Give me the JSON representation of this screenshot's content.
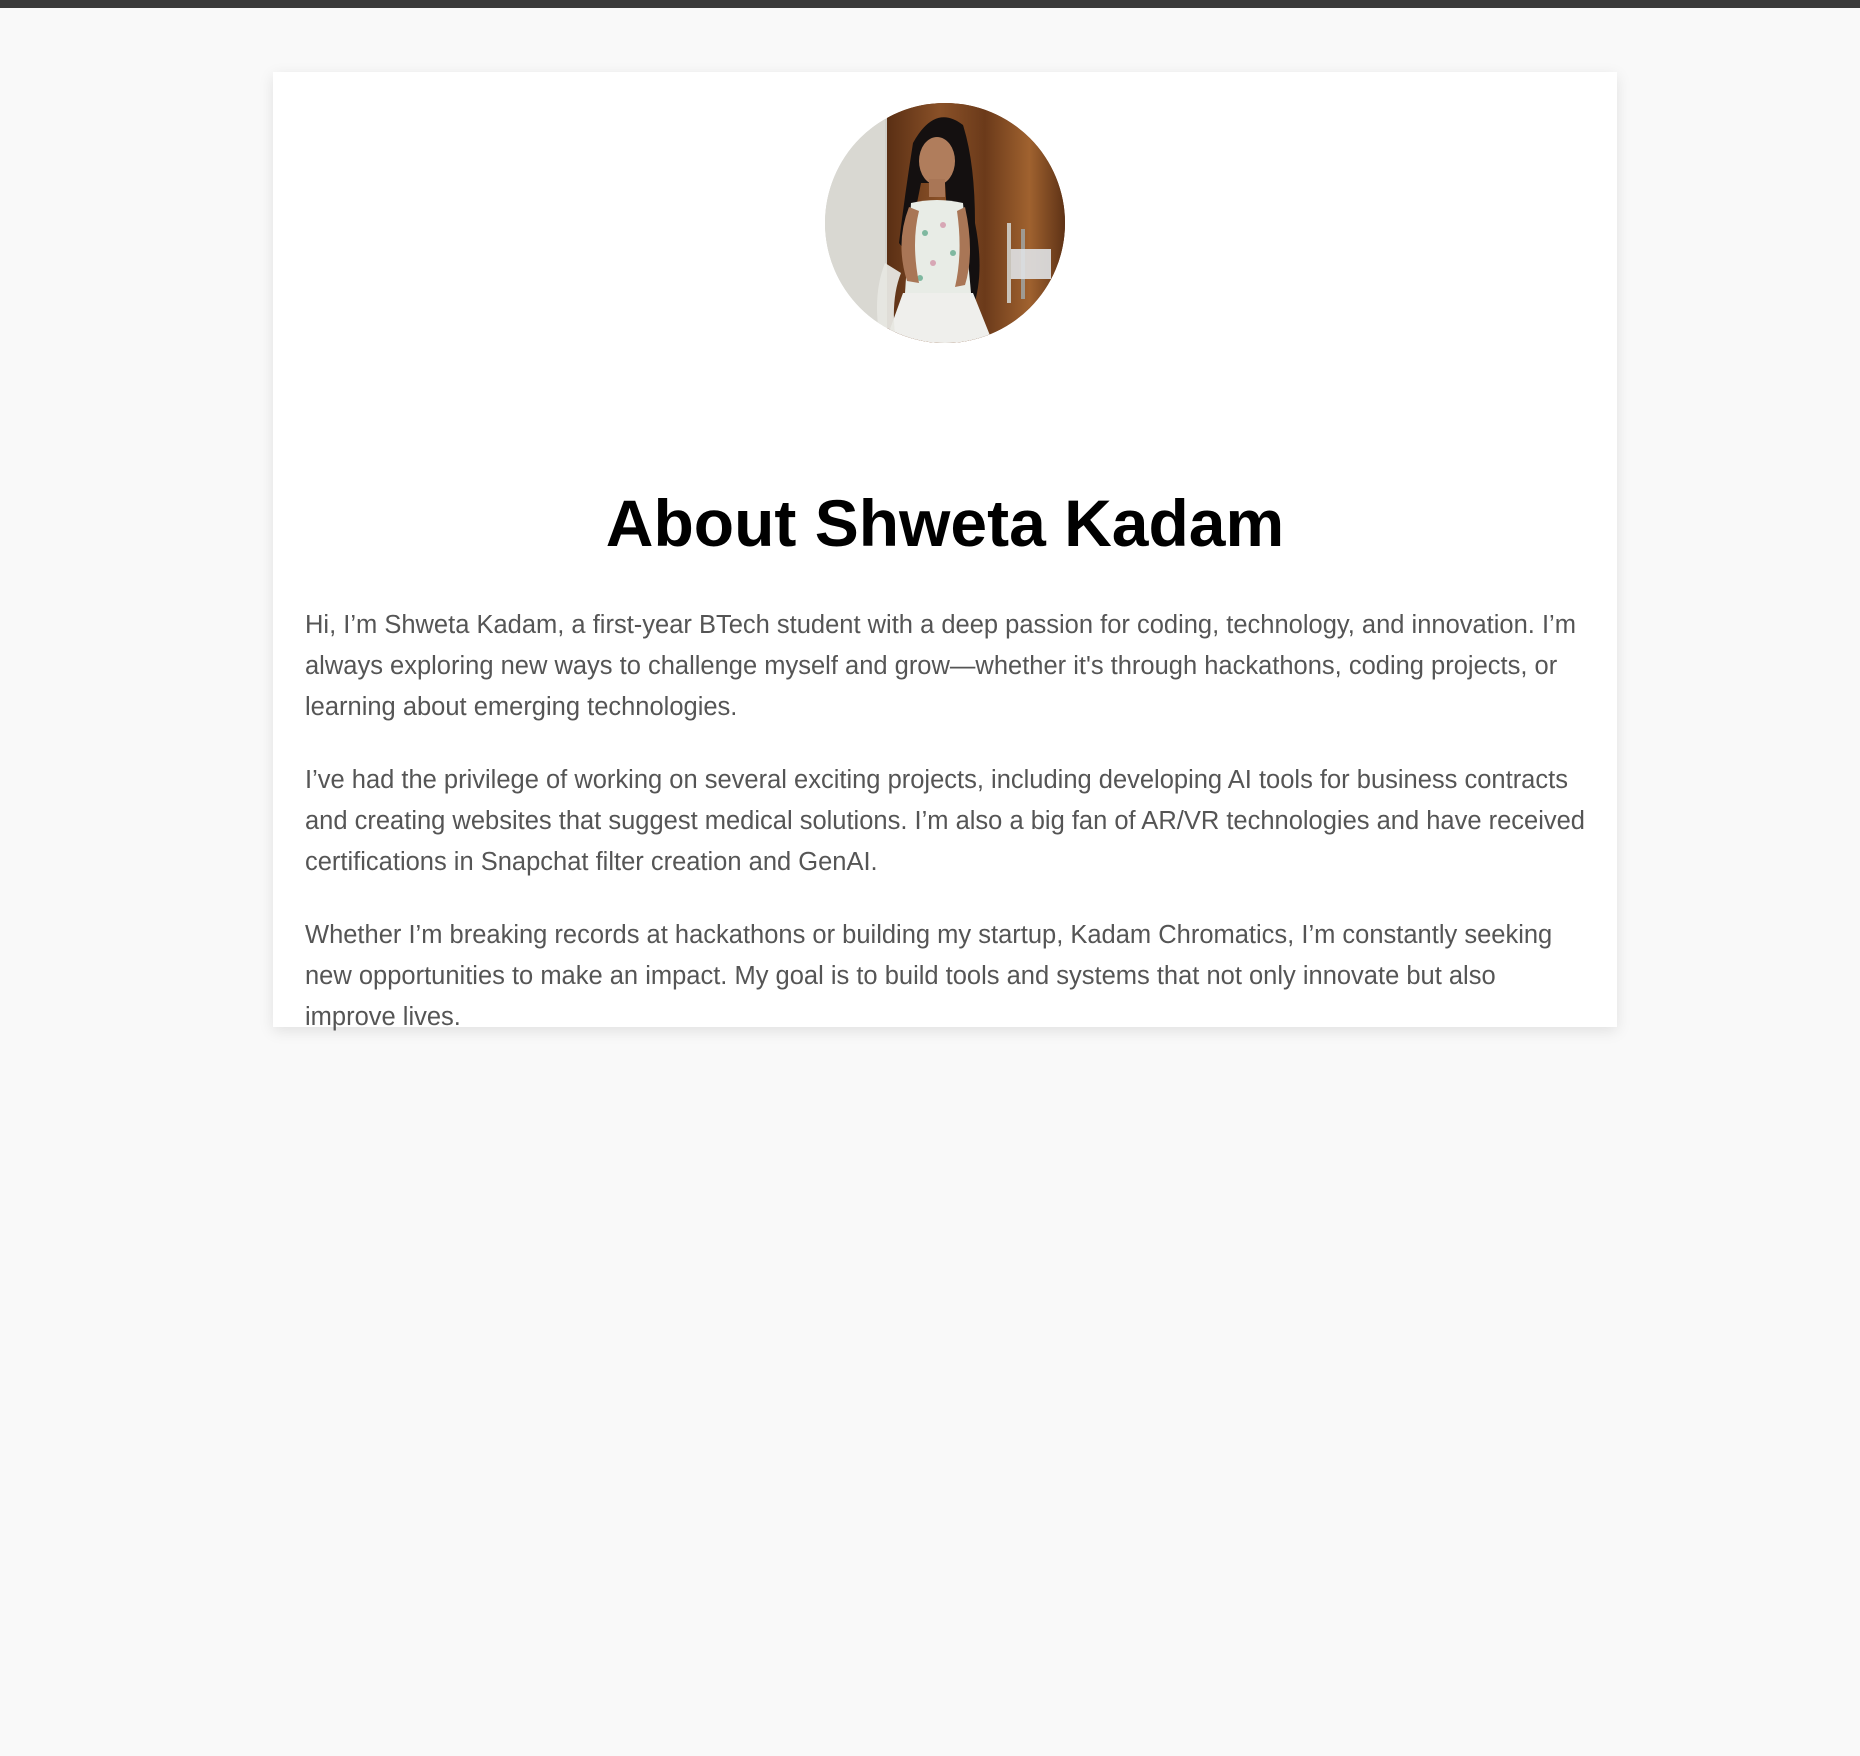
{
  "page": {
    "background_color": "#f9f9f9",
    "top_bar_color": "#3a3a3a"
  },
  "profile": {
    "avatar_alt": "Shweta Kadam profile photo",
    "title": "About Shweta Kadam",
    "paragraphs": [
      "Hi, I’m Shweta Kadam, a first-year BTech student with a deep passion for coding, technology, and innovation. I’m always exploring new ways to challenge myself and grow—whether it's through hackathons, coding projects, or learning about emerging technologies.",
      "I’ve had the privilege of working on several exciting projects, including developing AI tools for business contracts and creating websites that suggest medical solutions. I’m also a big fan of AR/VR technologies and have received certifications in Snapchat filter creation and GenAI.",
      "Whether I’m breaking records at hackathons or building my startup, Kadam Chromatics, I’m constantly seeking new opportunities to make an impact. My goal is to build tools and systems that not only innovate but also improve lives."
    ]
  }
}
